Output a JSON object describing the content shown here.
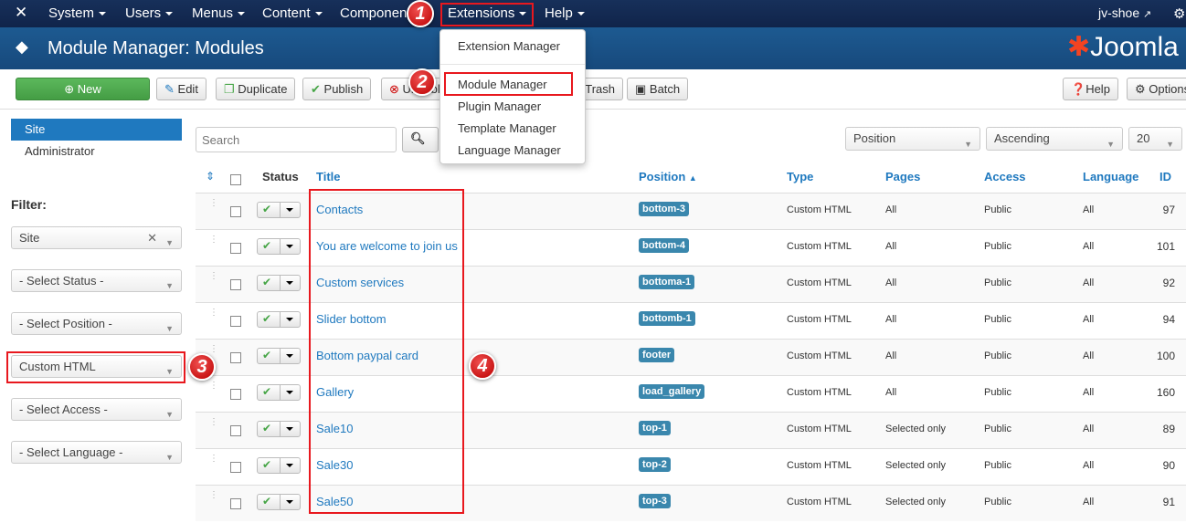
{
  "nav": {
    "items": [
      "System",
      "Users",
      "Menus",
      "Content",
      "Components",
      "Extensions",
      "Help"
    ],
    "user": "jv-shoe"
  },
  "header": {
    "title": "Module Manager: Modules",
    "brand": "Joomla"
  },
  "toolbar": {
    "new": "New",
    "edit": "Edit",
    "duplicate": "Duplicate",
    "publish": "Publish",
    "unpublish": "Unpublish",
    "trash": "Trash",
    "batch": "Batch",
    "help": "Help",
    "options": "Options"
  },
  "extensions_menu": [
    "Extension Manager",
    "Module Manager",
    "Plugin Manager",
    "Template Manager",
    "Language Manager"
  ],
  "sidebar": {
    "items": [
      "Site",
      "Administrator"
    ],
    "filter_label": "Filter:",
    "filters": [
      "Site",
      "- Select Status -",
      "- Select Position -",
      "Custom HTML",
      "- Select Access -",
      "- Select Language -"
    ]
  },
  "search": {
    "placeholder": "Search"
  },
  "sorting": {
    "field": "Position",
    "direction": "Ascending",
    "limit": "20"
  },
  "columns": [
    "Status",
    "Title",
    "Position",
    "Type",
    "Pages",
    "Access",
    "Language",
    "ID"
  ],
  "rows": [
    {
      "title": "Contacts",
      "position": "bottom-3",
      "type": "Custom HTML",
      "pages": "All",
      "access": "Public",
      "language": "All",
      "id": "97"
    },
    {
      "title": "You are welcome to join us",
      "position": "bottom-4",
      "type": "Custom HTML",
      "pages": "All",
      "access": "Public",
      "language": "All",
      "id": "101"
    },
    {
      "title": "Custom services",
      "position": "bottoma-1",
      "type": "Custom HTML",
      "pages": "All",
      "access": "Public",
      "language": "All",
      "id": "92"
    },
    {
      "title": "Slider bottom",
      "position": "bottomb-1",
      "type": "Custom HTML",
      "pages": "All",
      "access": "Public",
      "language": "All",
      "id": "94"
    },
    {
      "title": "Bottom paypal card",
      "position": "footer",
      "type": "Custom HTML",
      "pages": "All",
      "access": "Public",
      "language": "All",
      "id": "100"
    },
    {
      "title": "Gallery",
      "position": "load_gallery",
      "type": "Custom HTML",
      "pages": "All",
      "access": "Public",
      "language": "All",
      "id": "160"
    },
    {
      "title": "Sale10",
      "position": "top-1",
      "type": "Custom HTML",
      "pages": "Selected only",
      "access": "Public",
      "language": "All",
      "id": "89"
    },
    {
      "title": "Sale30",
      "position": "top-2",
      "type": "Custom HTML",
      "pages": "Selected only",
      "access": "Public",
      "language": "All",
      "id": "90"
    },
    {
      "title": "Sale50",
      "position": "top-3",
      "type": "Custom HTML",
      "pages": "Selected only",
      "access": "Public",
      "language": "All",
      "id": "91"
    }
  ],
  "annotations": [
    "1",
    "2",
    "3",
    "4"
  ],
  "colors": {
    "accent": "#1f79bf",
    "badge": "#3a87ad",
    "highlight": "#e8181e",
    "new_button": "#5cb85c"
  }
}
